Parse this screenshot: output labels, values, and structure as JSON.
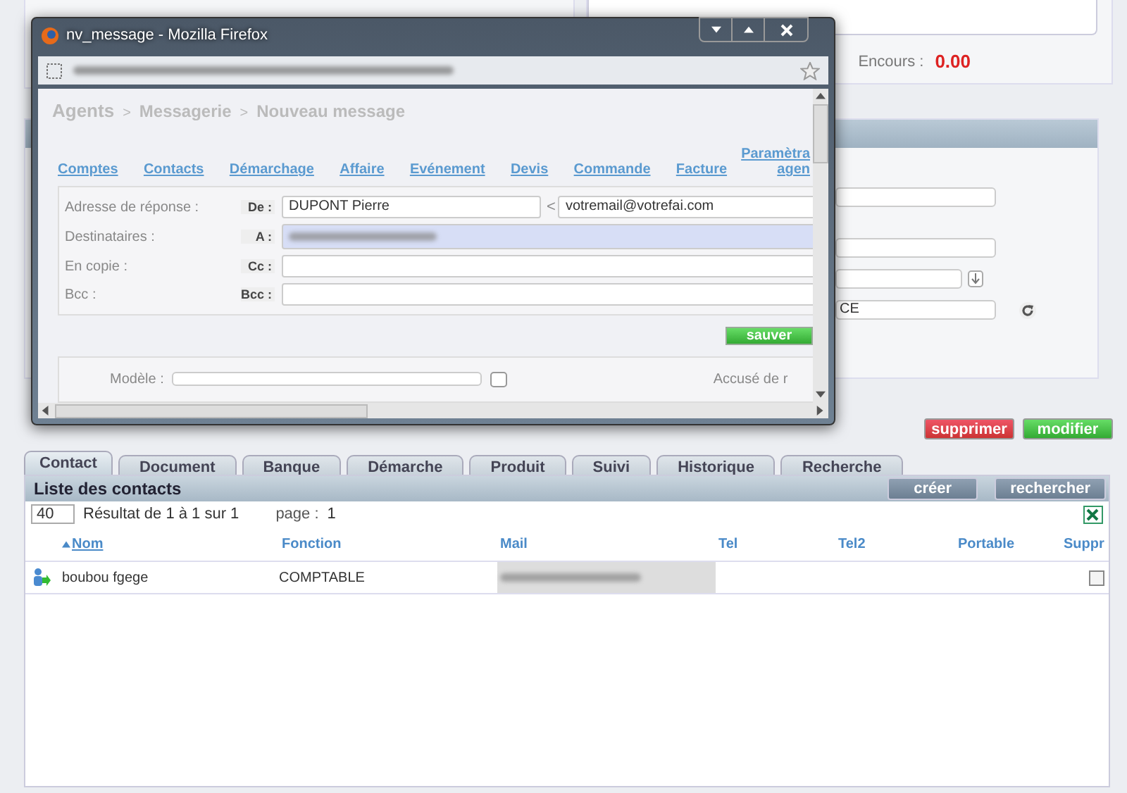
{
  "background": {
    "encours_label": "Encours :",
    "encours_value": "0.00",
    "partial_field_value": "CE"
  },
  "actions": [
    {
      "label": "supprimer",
      "kind": "danger"
    },
    {
      "label": "modifier",
      "kind": "primary"
    }
  ],
  "tabs": [
    {
      "label": "Contact",
      "selected": true
    },
    {
      "label": "Document",
      "selected": false
    },
    {
      "label": "Banque",
      "selected": false
    },
    {
      "label": "Démarche",
      "selected": false
    },
    {
      "label": "Produit",
      "selected": false
    },
    {
      "label": "Suivi",
      "selected": false
    },
    {
      "label": "Historique",
      "selected": false
    },
    {
      "label": "Recherche",
      "selected": false
    }
  ],
  "contacts_panel": {
    "title": "Liste des contacts",
    "buttons": [
      "créer",
      "rechercher"
    ],
    "page_size": "40",
    "result": "Résultat de 1 à 1 sur 1",
    "page_label": "page :",
    "page": "1",
    "columns": [
      {
        "label": "Nom",
        "sorted": true
      },
      {
        "label": "Fonction",
        "sorted": false
      },
      {
        "label": "Mail",
        "sorted": false
      },
      {
        "label": "Tel",
        "sorted": false
      },
      {
        "label": "Tel2",
        "sorted": false
      },
      {
        "label": "Portable",
        "sorted": false
      },
      {
        "label": "Suppr",
        "sorted": false
      }
    ],
    "rows": [
      {
        "nom": "boubou fgege",
        "fonction": "COMPTABLE",
        "checked": false
      }
    ]
  },
  "popup": {
    "title": "nv_message - Mozilla Firefox",
    "breadcrumb": [
      "Agents",
      "Messagerie",
      "Nouveau message"
    ],
    "separator": ">",
    "nav": [
      "Comptes",
      "Contacts",
      "Démarchage",
      "Affaire",
      "Evénement",
      "Devis",
      "Commande",
      "Facture"
    ],
    "nav_cut": [
      "Paramètra",
      "agen"
    ],
    "form": [
      {
        "label": "Adresse de réponse :",
        "tag": "De :",
        "value": "DUPONT Pierre",
        "separator": "<",
        "email": "votremail@votrefai.com",
        "focused": false
      },
      {
        "label": "Destinataires :",
        "tag": "A :",
        "focused": true
      },
      {
        "label": "En copie :",
        "tag": "Cc :",
        "focused": false
      },
      {
        "label": "Bcc :",
        "tag": "Bcc :",
        "focused": false
      }
    ],
    "save": "sauver",
    "model_label": "Modèle :",
    "receipt_label": "Accusé de r"
  }
}
